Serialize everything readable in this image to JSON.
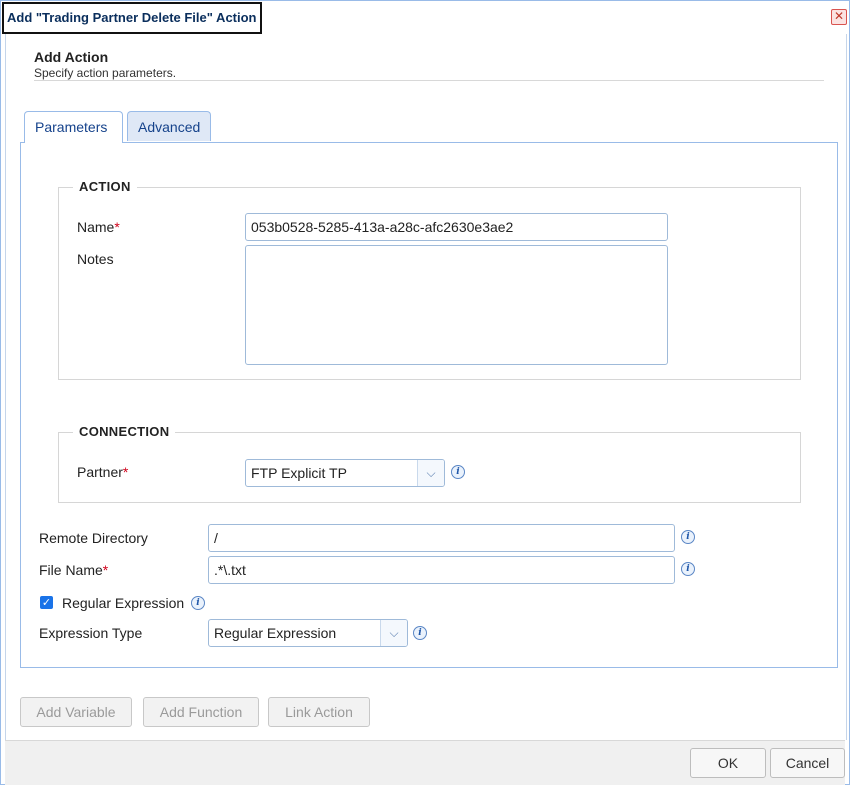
{
  "window": {
    "title": "Add \"Trading Partner Delete File\" Action",
    "close_glyph": "✕"
  },
  "header": {
    "title": "Add Action",
    "subtitle": "Specify action parameters."
  },
  "tabs": [
    {
      "label": "Parameters",
      "active": true
    },
    {
      "label": "Advanced",
      "active": false
    }
  ],
  "action_section": {
    "legend": "ACTION",
    "name_label": "Name",
    "name_value": "053b0528-5285-413a-a28c-afc2630e3ae2",
    "notes_label": "Notes",
    "notes_value": ""
  },
  "connection_section": {
    "legend": "CONNECTION",
    "partner_label": "Partner",
    "partner_value": "FTP Explicit TP"
  },
  "fields": {
    "remote_dir_label": "Remote Directory",
    "remote_dir_value": "/",
    "file_name_label": "File Name",
    "file_name_value": ".*\\.txt",
    "regex_label": "Regular Expression",
    "regex_checked": true,
    "expr_type_label": "Expression Type",
    "expr_type_value": "Regular Expression"
  },
  "required_marker": "*",
  "info_glyph": "i",
  "check_glyph": "✓",
  "dropdown_glyph": "⌵",
  "toolbar": {
    "add_variable": "Add Variable",
    "add_function": "Add Function",
    "link_action": "Link Action"
  },
  "footer": {
    "ok": "OK",
    "cancel": "Cancel"
  },
  "colors": {
    "accent": "#15428b",
    "border": "#99bbe8",
    "required": "#d0021b",
    "checkbox": "#1a73e8"
  }
}
